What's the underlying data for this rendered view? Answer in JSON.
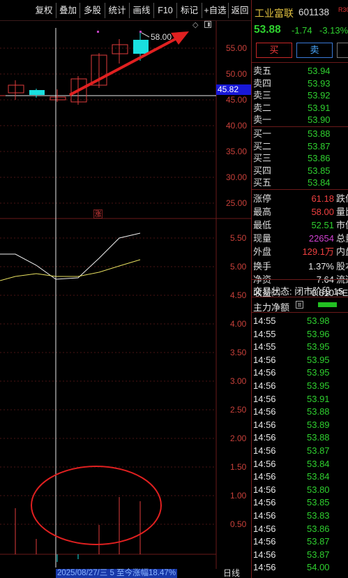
{
  "toolbar": {
    "items": [
      "复权",
      "叠加",
      "多股",
      "统计",
      "画线",
      "F10",
      "标记",
      "+自选",
      "返回"
    ]
  },
  "stock": {
    "name": "工业富联",
    "code": "601138",
    "margin_tag": "R30",
    "last": "53.88",
    "change": "-1.74",
    "change_pct": "-3.13%"
  },
  "trade": {
    "buy": "买",
    "sell": "卖",
    "more": ""
  },
  "order_book": {
    "asks": [
      {
        "label": "卖五",
        "price": "53.94"
      },
      {
        "label": "卖四",
        "price": "53.93"
      },
      {
        "label": "卖三",
        "price": "53.92"
      },
      {
        "label": "卖二",
        "price": "53.91"
      },
      {
        "label": "卖一",
        "price": "53.90"
      }
    ],
    "bids": [
      {
        "label": "买一",
        "price": "53.88"
      },
      {
        "label": "买二",
        "price": "53.87"
      },
      {
        "label": "买三",
        "price": "53.86"
      },
      {
        "label": "买四",
        "price": "53.85"
      },
      {
        "label": "买五",
        "price": "53.84"
      }
    ]
  },
  "stats": [
    {
      "label": "涨停",
      "value": "61.18",
      "color": "#f04040",
      "label2": "跌停"
    },
    {
      "label": "最高",
      "value": "58.00",
      "color": "#f04040",
      "label2": "量比"
    },
    {
      "label": "最低",
      "value": "52.51",
      "color": "#2fd02f",
      "label2": "市值"
    },
    {
      "label": "现量",
      "value": "22654",
      "color": "#d040d0",
      "label2": "总量"
    },
    {
      "label": "外盘",
      "value": "129.1万",
      "color": "#f04040",
      "label2": "内盘"
    },
    {
      "label": "换手",
      "value": "1.37%",
      "color": "#e8e8e8",
      "label2": "股本"
    },
    {
      "label": "净资",
      "value": "7.64",
      "color": "#e8e8e8",
      "label2": "流通"
    },
    {
      "label": "收益㈡",
      "value": "0.610",
      "color": "#e8e8e8",
      "label2": "PE"
    }
  ],
  "status_line": "交易状态: 闭市阶段 15",
  "netflow_label": "主力净额",
  "ticks": [
    {
      "time": "14:55",
      "price": "53.98"
    },
    {
      "time": "14:55",
      "price": "53.96"
    },
    {
      "time": "14:55",
      "price": "53.95"
    },
    {
      "time": "14:56",
      "price": "53.95"
    },
    {
      "time": "14:56",
      "price": "53.95"
    },
    {
      "time": "14:56",
      "price": "53.95"
    },
    {
      "time": "14:56",
      "price": "53.91"
    },
    {
      "time": "14:56",
      "price": "53.88"
    },
    {
      "time": "14:56",
      "price": "53.89"
    },
    {
      "time": "14:56",
      "price": "53.88"
    },
    {
      "time": "14:56",
      "price": "53.87"
    },
    {
      "time": "14:56",
      "price": "53.84"
    },
    {
      "time": "14:56",
      "price": "53.84"
    },
    {
      "time": "14:56",
      "price": "53.80"
    },
    {
      "time": "14:56",
      "price": "53.85"
    },
    {
      "time": "14:56",
      "price": "53.83"
    },
    {
      "time": "14:56",
      "price": "53.86"
    },
    {
      "time": "14:56",
      "price": "53.87"
    },
    {
      "time": "14:56",
      "price": "53.87"
    },
    {
      "time": "14:56",
      "price": "54.00"
    }
  ],
  "chart": {
    "current_price_tag": "45.82",
    "high_tag": "58.00",
    "limit_up_mark": "涨",
    "price_axis": [
      "55.00",
      "50.00",
      "45.00",
      "40.00",
      "35.00",
      "30.00",
      "25.00"
    ],
    "indicator_axis": [
      "5.50",
      "5.00",
      "4.50",
      "4.00",
      "3.50",
      "3.00",
      "2.50",
      "2.00",
      "1.50",
      "1.00",
      "0.50"
    ],
    "date_info": "2025/08/27/三 5 至今涨幅18.47%",
    "period": "日线",
    "colors": {
      "up": "#e03c3c",
      "down": "#19e0e0",
      "ma_white": "#f0f0f0",
      "ma_yellow": "#e8e060",
      "arrow": "#e02020"
    }
  }
}
